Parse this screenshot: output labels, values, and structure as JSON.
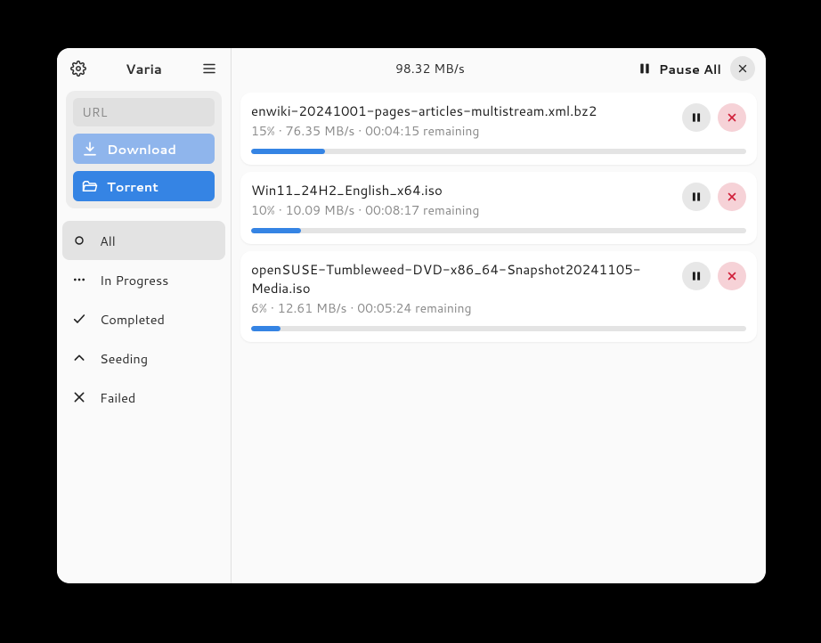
{
  "app_title": "Varia",
  "sidebar": {
    "url_placeholder": "URL",
    "download_label": "Download",
    "torrent_label": "Torrent",
    "filters": [
      {
        "id": "all",
        "label": "All",
        "icon": "circle",
        "active": true
      },
      {
        "id": "inprogress",
        "label": "In Progress",
        "icon": "dots",
        "active": false
      },
      {
        "id": "completed",
        "label": "Completed",
        "icon": "check",
        "active": false
      },
      {
        "id": "seeding",
        "label": "Seeding",
        "icon": "chevron-up",
        "active": false
      },
      {
        "id": "failed",
        "label": "Failed",
        "icon": "x",
        "active": false
      }
    ]
  },
  "header": {
    "total_speed": "98.32 MB/s",
    "pause_all_label": "Pause All"
  },
  "downloads": [
    {
      "name": "enwiki-20241001-pages-articles-multistream.xml.bz2",
      "percent": 15,
      "speed": "76.35  MB/s",
      "remaining": "00:04:15 remaining"
    },
    {
      "name": "Win11_24H2_English_x64.iso",
      "percent": 10,
      "speed": "10.09  MB/s",
      "remaining": "00:08:17 remaining"
    },
    {
      "name": "openSUSE-Tumbleweed-DVD-x86_64-Snapshot20241105-Media.iso",
      "percent": 6,
      "speed": "12.61  MB/s",
      "remaining": "00:05:24 remaining"
    }
  ]
}
